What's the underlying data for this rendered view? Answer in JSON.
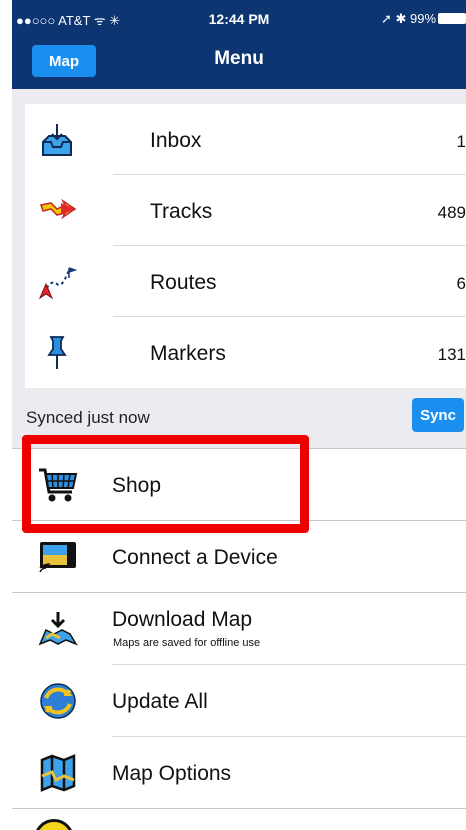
{
  "status_bar": {
    "carrier": "●●○○○ AT&T ᯤ ✳",
    "time": "12:44 PM",
    "right": "➚ ✱ 99%"
  },
  "header": {
    "map_button": "Map",
    "title": "Menu"
  },
  "card": {
    "items": [
      {
        "label": "Inbox",
        "count": "1",
        "icon": "inbox-icon"
      },
      {
        "label": "Tracks",
        "count": "489",
        "icon": "track-arrow-icon"
      },
      {
        "label": "Routes",
        "count": "6",
        "icon": "route-icon"
      },
      {
        "label": "Markers",
        "count": "131",
        "icon": "pushpin-icon"
      }
    ]
  },
  "sync": {
    "status": "Synced just now",
    "button": "Sync"
  },
  "list": {
    "items": [
      {
        "label": "Shop",
        "icon": "shopping-cart-icon"
      },
      {
        "label": "Connect a Device",
        "icon": "gps-device-icon"
      },
      {
        "label": "Download Map",
        "subtitle": "Maps are saved for offline use",
        "icon": "download-map-icon"
      },
      {
        "label": "Update All",
        "icon": "update-globe-icon"
      },
      {
        "label": "Map Options",
        "icon": "folded-map-icon"
      }
    ]
  },
  "colors": {
    "header_bg": "#0d3572",
    "accent_blue": "#1b8ff0",
    "highlight_red": "#ee0000"
  }
}
